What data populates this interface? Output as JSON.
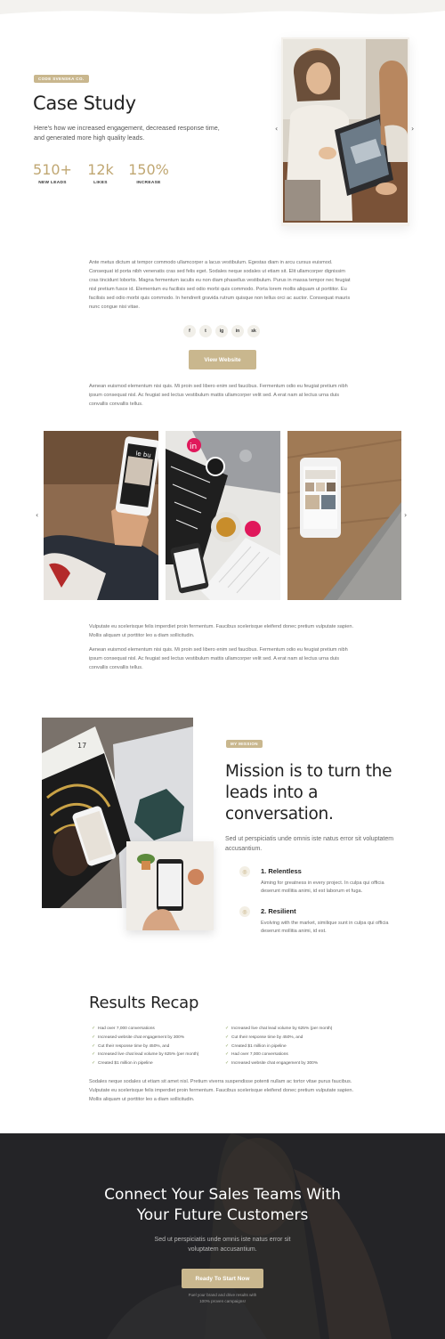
{
  "hero": {
    "tag": "CODE SVENSKA CO.",
    "title": "Case Study",
    "subtitle": "Here's how we increased engagement, decreased response time, and generated more high quality leads.",
    "stats": [
      {
        "value": "510+",
        "label": "NEW LEADS"
      },
      {
        "value": "12k",
        "label": "LIKES"
      },
      {
        "value": "150%",
        "label": "INCREASE"
      }
    ],
    "prev_arrow": "‹",
    "next_arrow": "›"
  },
  "intro": {
    "paragraph": "Ante metus dictum at tempor commodo ullamcorper a lacus vestibulum. Egestas diam in arcu cursus euismod. Consequat id porta nibh venenatis cras sed felis eget. Sodales neque sodales ut etiam sit. Elit ullamcorper dignissim cras tincidunt lobortis. Magna fermentum iaculis eu non diam phasellus vestibulum. Purus in massa tempor nec feugiat nisl pretium fusce id. Elementum eu facilisis sed odio morbi quis commodo. Porta lorem mollis aliquam ut porttitor. Eu facilisis sed odio morbi quis commodo. In hendrerit gravida rutrum quisque non tellus orci ac auctor. Consequat mauris nunc congue nisi vitae.",
    "social": [
      "f",
      "t",
      "ig",
      "in",
      "sk"
    ],
    "button": "View Website",
    "paragraph2": "Aenean euismod elementum nisi quis. Mi proin sed libero enim sed faucibus. Fermentum odio eu feugiat pretium nibh ipsum consequat nisl. Ac feugiat sed lectus vestibulum mattis ullamcorper velit sed. A erat nam at lectus urna duis convallis convallis tellus."
  },
  "gallery": {
    "prev_arrow": "‹",
    "next_arrow": "›",
    "phone_brand": "in"
  },
  "body": {
    "paragraph1": "Vulputate eu scelerisque felis imperdiet proin fermentum. Faucibus scelerisque eleifend donec pretium vulputate sapien. Mollis aliquam ut porttitor leo a diam sollicitudin.",
    "paragraph2": "Aenean euismod elementum nisi quis. Mi proin sed libero enim sed faucibus. Fermentum odio eu feugiat pretium nibh ipsum consequat nisl. Ac feugiat sed lectus vestibulum mattis ullamcorper velit sed. A erat nam at lectus urna duis convallis convallis tellus."
  },
  "mission": {
    "tag": "MY MISSION",
    "title": "Mission is to turn the leads into a conversation.",
    "subtitle": "Sed ut perspiciatis unde omnis iste natus error sit voluptatem accusantium.",
    "features": [
      {
        "title": "1. Relentless",
        "text": "Aiming for greatness in every project. In culpa qui officia deserunt mollitia animi, id est laborum et fuga."
      },
      {
        "title": "2. Resilient",
        "text": "Evolving with the market, similique sunt in culpa qui officia deserunt mollitia animi, id est."
      }
    ]
  },
  "recap": {
    "title": "Results Recap",
    "left_list": [
      "Had over 7,000 conversations",
      "Increased website chat engagement by 300%",
      "Cut their response time by 450%, and",
      "Increased live chat lead volume by 625% (per month)",
      "Created $1 million in pipeline"
    ],
    "right_list": [
      "Increased live chat lead volume by 625% (per month)",
      "Cut their response time by 450%, and",
      "Created $1 million in pipeline",
      "Had over 7,000 conversations",
      "Increased website chat engagement by 300%"
    ],
    "paragraph": "Sodales neque sodales ut etiam sit amet nisl. Pretium viverra suspendisse potenti nullam ac tortor vitae purus faucibus. Vulputate eu scelerisque felis imperdiet proin fermentum. Faucibus scelerisque eleifend donec pretium vulputate sapien. Mollis aliquam ut porttitor leo a diam sollicitudin."
  },
  "cta": {
    "title_line1": "Connect Your Sales Teams With",
    "title_line2": "Your Future Customers",
    "subtitle_line1": "Sed ut perspiciatis unde omnis iste natus error sit",
    "subtitle_line2": "voluptatem accusantium.",
    "button": "Ready To Start Now",
    "small_line1": "Fuel your brand and drive results with",
    "small_line2": "100% proven campaigns!"
  },
  "colors": {
    "accent": "#c9b78e",
    "accent_text": "#c0a772",
    "check": "#8aa35c",
    "dark": "#2a2a2c"
  }
}
